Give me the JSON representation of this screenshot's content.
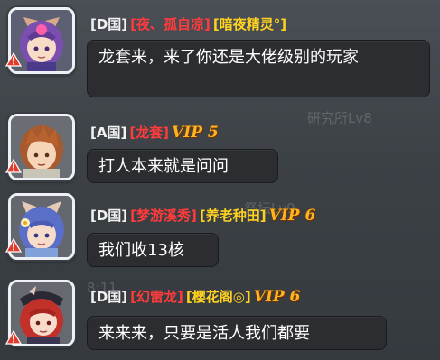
{
  "background": {
    "faded_labels": [
      "研究所Lv8",
      "祭坛Lv9",
      "8:11"
    ]
  },
  "messages": [
    {
      "country": "[D国]",
      "tags": [
        {
          "text": "[夜、孤自凉]",
          "color": "red"
        },
        {
          "text": "[暗夜精灵°]",
          "color": "yellow"
        }
      ],
      "vip": "",
      "text": "龙套来，来了你还是大佬级别的玩家",
      "avatar": "purple-hair-fox-girl"
    },
    {
      "country": "[A国]",
      "tags": [
        {
          "text": "[龙套]",
          "color": "red"
        }
      ],
      "vip": "VIP 5",
      "text": "打人本来就是问问",
      "avatar": "brown-hair-boy"
    },
    {
      "country": "[D国]",
      "tags": [
        {
          "text": "[梦游溪秀]",
          "color": "red"
        },
        {
          "text": "[养老种田]",
          "color": "yellow"
        }
      ],
      "vip": "VIP 6",
      "text": "我们收13核",
      "avatar": "blue-hair-flower-girl"
    },
    {
      "country": "[D国]",
      "tags": [
        {
          "text": "[幻雷龙]",
          "color": "red"
        },
        {
          "text": "[樱花阁◎]",
          "color": "yellow"
        }
      ],
      "vip": "VIP 6",
      "text": "来来来，只要是活人我们都要",
      "avatar": "red-hair-pirate-girl"
    }
  ],
  "colors": {
    "red_tag": "#ff3b3b",
    "yellow_tag": "#ffd21f",
    "vip": "#ffb41f",
    "bubble_bg": "#2c2d31"
  }
}
